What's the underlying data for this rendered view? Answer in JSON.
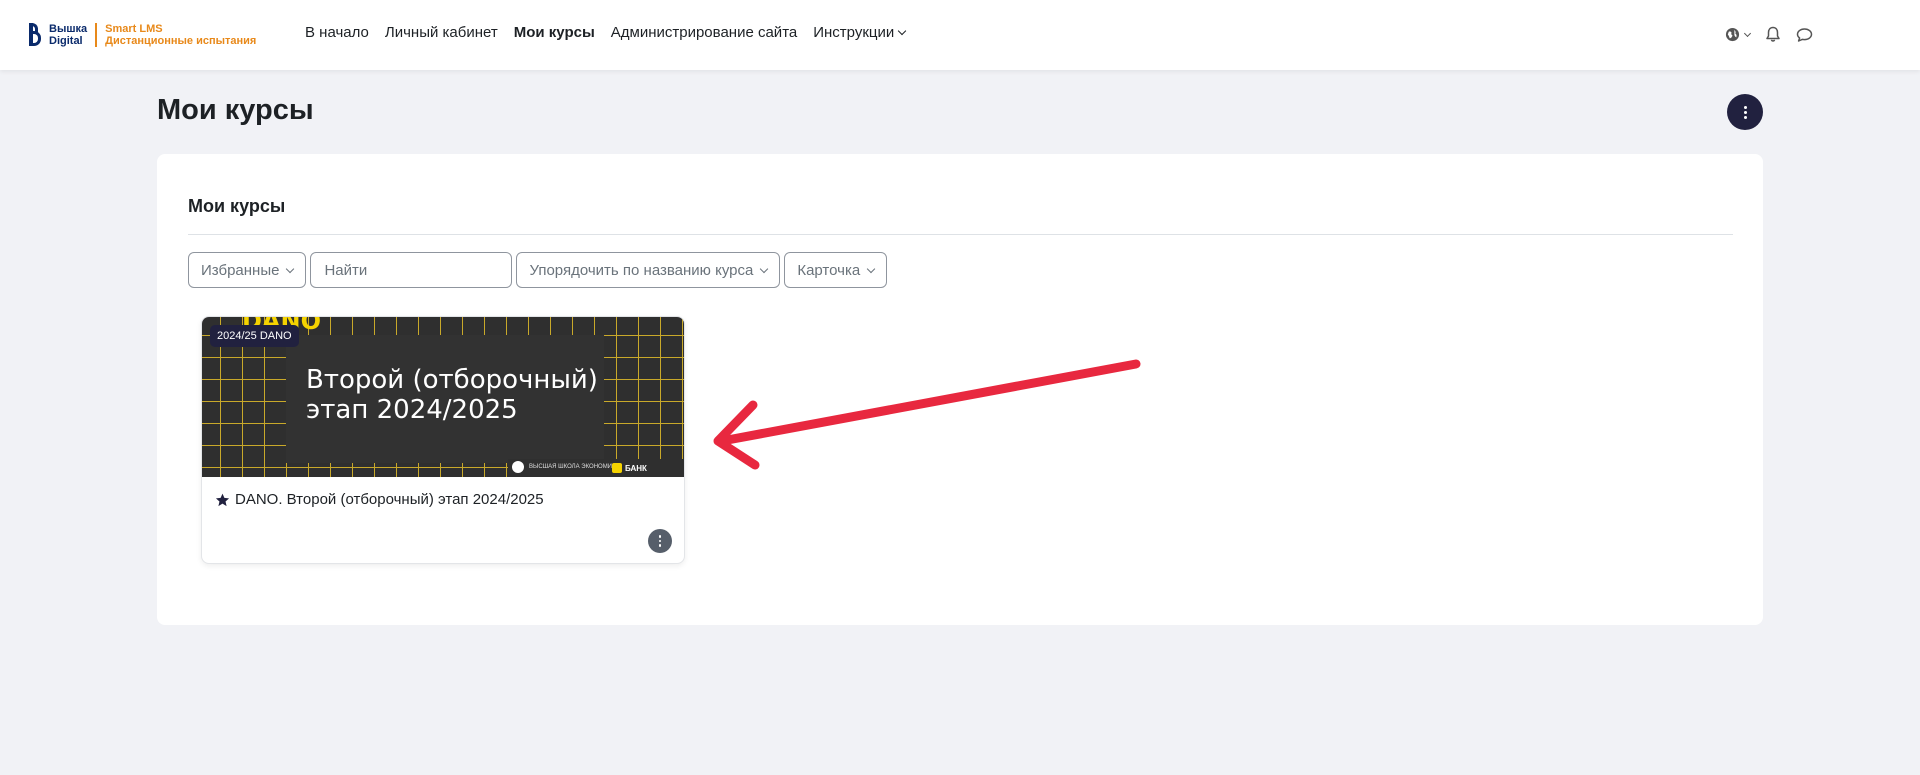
{
  "brand": {
    "name_line1": "Вышка",
    "name_line2": "Digital",
    "product_line1": "Smart LMS",
    "product_line2": "Дистанционные испытания",
    "primary_color": "#0a2a6b",
    "accent_color": "#e8891a"
  },
  "nav": {
    "items": [
      {
        "label": "В начало"
      },
      {
        "label": "Личный кабинет"
      },
      {
        "label": "Мои курсы",
        "active": true
      },
      {
        "label": "Администрирование сайта"
      },
      {
        "label": "Инструкции",
        "has_dropdown": true
      }
    ],
    "icons": [
      "globe-icon",
      "bell-icon",
      "chat-icon"
    ]
  },
  "page": {
    "title": "Мои курсы"
  },
  "block": {
    "title": "Мои курсы",
    "filters": {
      "grouping": "Избранные",
      "search_placeholder": "Найти",
      "sort": "Упорядочить по названию курса",
      "view": "Карточка"
    }
  },
  "courses": [
    {
      "category_badge": "2024/25 DANO",
      "image_title_line1": "Второй (отборочный)",
      "image_title_line2": "этап 2024/2025",
      "image_logo_fragment": "DANO",
      "image_partner1": "ВЫСШАЯ ШКОЛА ЭКОНОМИКИ",
      "image_partner2": "БАНК",
      "name": "DANO. Второй (отборочный) этап 2024/2025",
      "starred": true
    }
  ],
  "colors": {
    "page_bg": "#f1f2f6",
    "dark_button": "#21213f",
    "annotation_arrow": "#e8283f"
  }
}
